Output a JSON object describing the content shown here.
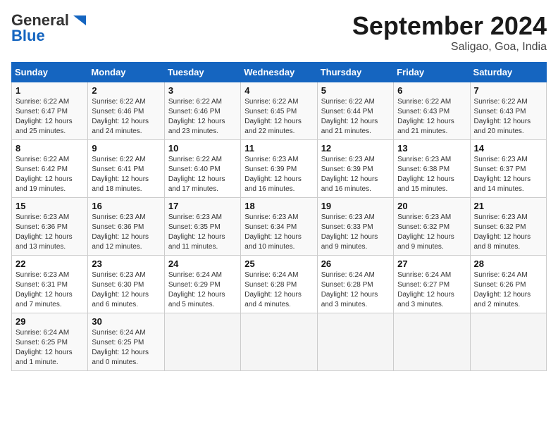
{
  "header": {
    "logo_general": "General",
    "logo_blue": "Blue",
    "month_title": "September 2024",
    "location": "Saligao, Goa, India"
  },
  "days_of_week": [
    "Sunday",
    "Monday",
    "Tuesday",
    "Wednesday",
    "Thursday",
    "Friday",
    "Saturday"
  ],
  "weeks": [
    [
      {
        "day": "1",
        "sunrise": "6:22 AM",
        "sunset": "6:47 PM",
        "daylight": "12 hours and 25 minutes."
      },
      {
        "day": "2",
        "sunrise": "6:22 AM",
        "sunset": "6:46 PM",
        "daylight": "12 hours and 24 minutes."
      },
      {
        "day": "3",
        "sunrise": "6:22 AM",
        "sunset": "6:46 PM",
        "daylight": "12 hours and 23 minutes."
      },
      {
        "day": "4",
        "sunrise": "6:22 AM",
        "sunset": "6:45 PM",
        "daylight": "12 hours and 22 minutes."
      },
      {
        "day": "5",
        "sunrise": "6:22 AM",
        "sunset": "6:44 PM",
        "daylight": "12 hours and 21 minutes."
      },
      {
        "day": "6",
        "sunrise": "6:22 AM",
        "sunset": "6:43 PM",
        "daylight": "12 hours and 21 minutes."
      },
      {
        "day": "7",
        "sunrise": "6:22 AM",
        "sunset": "6:43 PM",
        "daylight": "12 hours and 20 minutes."
      }
    ],
    [
      {
        "day": "8",
        "sunrise": "6:22 AM",
        "sunset": "6:42 PM",
        "daylight": "12 hours and 19 minutes."
      },
      {
        "day": "9",
        "sunrise": "6:22 AM",
        "sunset": "6:41 PM",
        "daylight": "12 hours and 18 minutes."
      },
      {
        "day": "10",
        "sunrise": "6:22 AM",
        "sunset": "6:40 PM",
        "daylight": "12 hours and 17 minutes."
      },
      {
        "day": "11",
        "sunrise": "6:23 AM",
        "sunset": "6:39 PM",
        "daylight": "12 hours and 16 minutes."
      },
      {
        "day": "12",
        "sunrise": "6:23 AM",
        "sunset": "6:39 PM",
        "daylight": "12 hours and 16 minutes."
      },
      {
        "day": "13",
        "sunrise": "6:23 AM",
        "sunset": "6:38 PM",
        "daylight": "12 hours and 15 minutes."
      },
      {
        "day": "14",
        "sunrise": "6:23 AM",
        "sunset": "6:37 PM",
        "daylight": "12 hours and 14 minutes."
      }
    ],
    [
      {
        "day": "15",
        "sunrise": "6:23 AM",
        "sunset": "6:36 PM",
        "daylight": "12 hours and 13 minutes."
      },
      {
        "day": "16",
        "sunrise": "6:23 AM",
        "sunset": "6:36 PM",
        "daylight": "12 hours and 12 minutes."
      },
      {
        "day": "17",
        "sunrise": "6:23 AM",
        "sunset": "6:35 PM",
        "daylight": "12 hours and 11 minutes."
      },
      {
        "day": "18",
        "sunrise": "6:23 AM",
        "sunset": "6:34 PM",
        "daylight": "12 hours and 10 minutes."
      },
      {
        "day": "19",
        "sunrise": "6:23 AM",
        "sunset": "6:33 PM",
        "daylight": "12 hours and 9 minutes."
      },
      {
        "day": "20",
        "sunrise": "6:23 AM",
        "sunset": "6:32 PM",
        "daylight": "12 hours and 9 minutes."
      },
      {
        "day": "21",
        "sunrise": "6:23 AM",
        "sunset": "6:32 PM",
        "daylight": "12 hours and 8 minutes."
      }
    ],
    [
      {
        "day": "22",
        "sunrise": "6:23 AM",
        "sunset": "6:31 PM",
        "daylight": "12 hours and 7 minutes."
      },
      {
        "day": "23",
        "sunrise": "6:23 AM",
        "sunset": "6:30 PM",
        "daylight": "12 hours and 6 minutes."
      },
      {
        "day": "24",
        "sunrise": "6:24 AM",
        "sunset": "6:29 PM",
        "daylight": "12 hours and 5 minutes."
      },
      {
        "day": "25",
        "sunrise": "6:24 AM",
        "sunset": "6:28 PM",
        "daylight": "12 hours and 4 minutes."
      },
      {
        "day": "26",
        "sunrise": "6:24 AM",
        "sunset": "6:28 PM",
        "daylight": "12 hours and 3 minutes."
      },
      {
        "day": "27",
        "sunrise": "6:24 AM",
        "sunset": "6:27 PM",
        "daylight": "12 hours and 3 minutes."
      },
      {
        "day": "28",
        "sunrise": "6:24 AM",
        "sunset": "6:26 PM",
        "daylight": "12 hours and 2 minutes."
      }
    ],
    [
      {
        "day": "29",
        "sunrise": "6:24 AM",
        "sunset": "6:25 PM",
        "daylight": "12 hours and 1 minute."
      },
      {
        "day": "30",
        "sunrise": "6:24 AM",
        "sunset": "6:25 PM",
        "daylight": "12 hours and 0 minutes."
      },
      null,
      null,
      null,
      null,
      null
    ]
  ]
}
